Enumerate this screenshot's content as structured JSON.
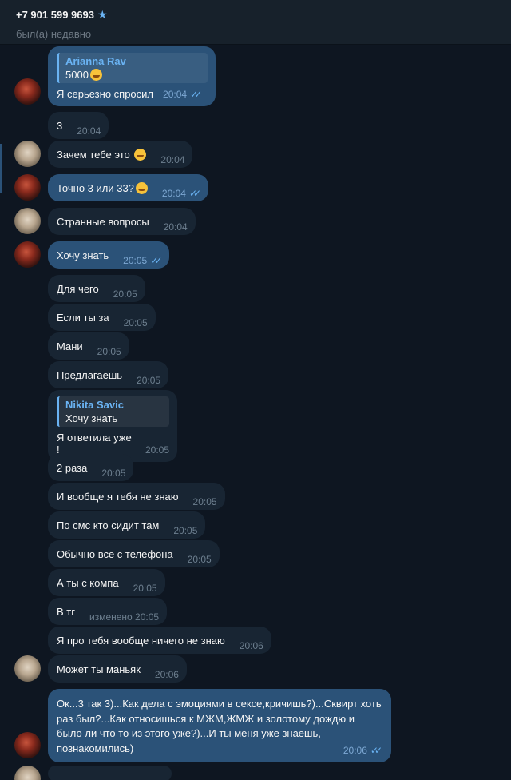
{
  "header": {
    "title": "+7 901 599 9693",
    "star_icon": "star-icon",
    "status": "был(а) недавно"
  },
  "messages": [
    {
      "reply_name": "Arianna Rav",
      "reply_text": "5000",
      "text": "Я серьезно спросил",
      "time": "20:04",
      "read": "✓✓"
    },
    {
      "text": "3",
      "time": "20:04"
    },
    {
      "text": "Зачем тебе это",
      "time": "20:04"
    },
    {
      "text": "Точно 3 или 33?",
      "time": "20:04",
      "read": "✓✓"
    },
    {
      "text": "Странные вопросы",
      "time": "20:04"
    },
    {
      "text": "Хочу знать",
      "time": "20:05",
      "read": "✓✓"
    },
    {
      "text": "Для чего",
      "time": "20:05"
    },
    {
      "text": "Если ты за",
      "time": "20:05"
    },
    {
      "text": "Мани",
      "time": "20:05"
    },
    {
      "text": "Предлагаешь",
      "time": "20:05"
    },
    {
      "reply_name": "Nikita Savic",
      "reply_text": "Хочу знать",
      "text": "Я ответила уже !",
      "time": "20:05"
    },
    {
      "text": "2 раза",
      "time": "20:05"
    },
    {
      "text": "И вообще я тебя не знаю",
      "time": "20:05"
    },
    {
      "text": "По смс кто сидит там",
      "time": "20:05"
    },
    {
      "text": "Обычно все с телефона",
      "time": "20:05"
    },
    {
      "text": "А ты с компа",
      "time": "20:05"
    },
    {
      "text": "В тг",
      "time": "изменено 20:05"
    },
    {
      "text": "Я про тебя вообще ничего не знаю",
      "time": "20:06"
    },
    {
      "text": "Может ты маньяк",
      "time": "20:06"
    },
    {
      "text": "Ок...3 так 3)...Как дела с эмоциями в сексе,кричишь?)...Сквирт хоть раз был?...Как относишься к МЖМ,ЖМЖ и золотому дождю и было ли что то из этого уже?)...И ты меня уже знаешь, познакомились)",
      "time": "20:06",
      "read": "✓✓"
    }
  ]
}
